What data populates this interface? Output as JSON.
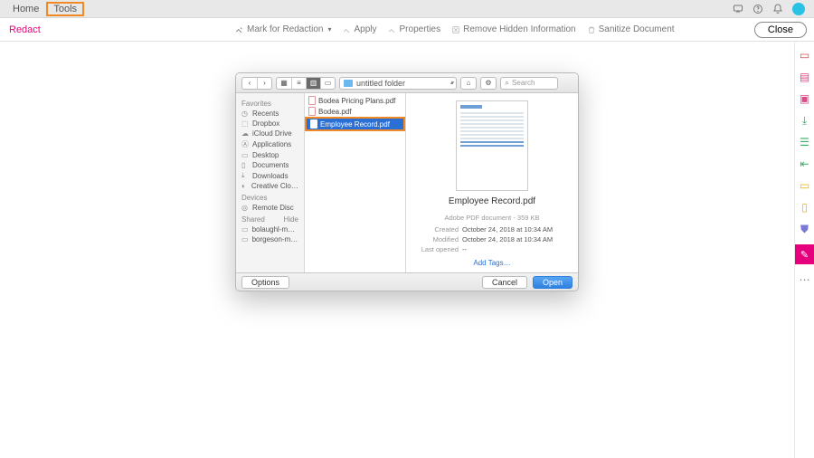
{
  "menubar": {
    "home": "Home",
    "tools": "Tools"
  },
  "toolbar": {
    "title": "Redact",
    "mark": "Mark for Redaction",
    "apply": "Apply",
    "properties": "Properties",
    "remove_hidden": "Remove Hidden Information",
    "sanitize": "Sanitize Document",
    "close": "Close"
  },
  "right_rail_icons": [
    "pdf-tool",
    "form-tool",
    "stamp-tool",
    "export-tool",
    "checklist-tool",
    "leftarrow-tool",
    "comment-tool",
    "clipboard-tool",
    "shield-tool",
    "sign-tool",
    "more-tool"
  ],
  "dialog": {
    "folder": "untitled folder",
    "search_placeholder": "Search",
    "sidebar": {
      "favorites_label": "Favorites",
      "favorites": [
        "Recents",
        "Dropbox",
        "iCloud Drive",
        "Applications",
        "Desktop",
        "Documents",
        "Downloads",
        "Creative Cloud…"
      ],
      "devices_label": "Devices",
      "devices": [
        "Remote Disc"
      ],
      "shared_label": "Shared",
      "shared_hide": "Hide",
      "shared": [
        "bolaughl-mac…",
        "borgeson-mac…"
      ]
    },
    "files": [
      {
        "name": "Bodea Pricing Plans.pdf",
        "selected": false
      },
      {
        "name": "Bodea.pdf",
        "selected": false
      },
      {
        "name": "Employee Record.pdf",
        "selected": true
      }
    ],
    "preview": {
      "filename": "Employee Record.pdf",
      "type_size": "Adobe PDF document - 359 KB",
      "created_label": "Created",
      "created": "October 24, 2018 at 10:34 AM",
      "modified_label": "Modified",
      "modified": "October 24, 2018 at 10:34 AM",
      "lastopened_label": "Last opened",
      "lastopened": "--",
      "addtags": "Add Tags…"
    },
    "footer": {
      "options": "Options",
      "cancel": "Cancel",
      "open": "Open"
    }
  }
}
